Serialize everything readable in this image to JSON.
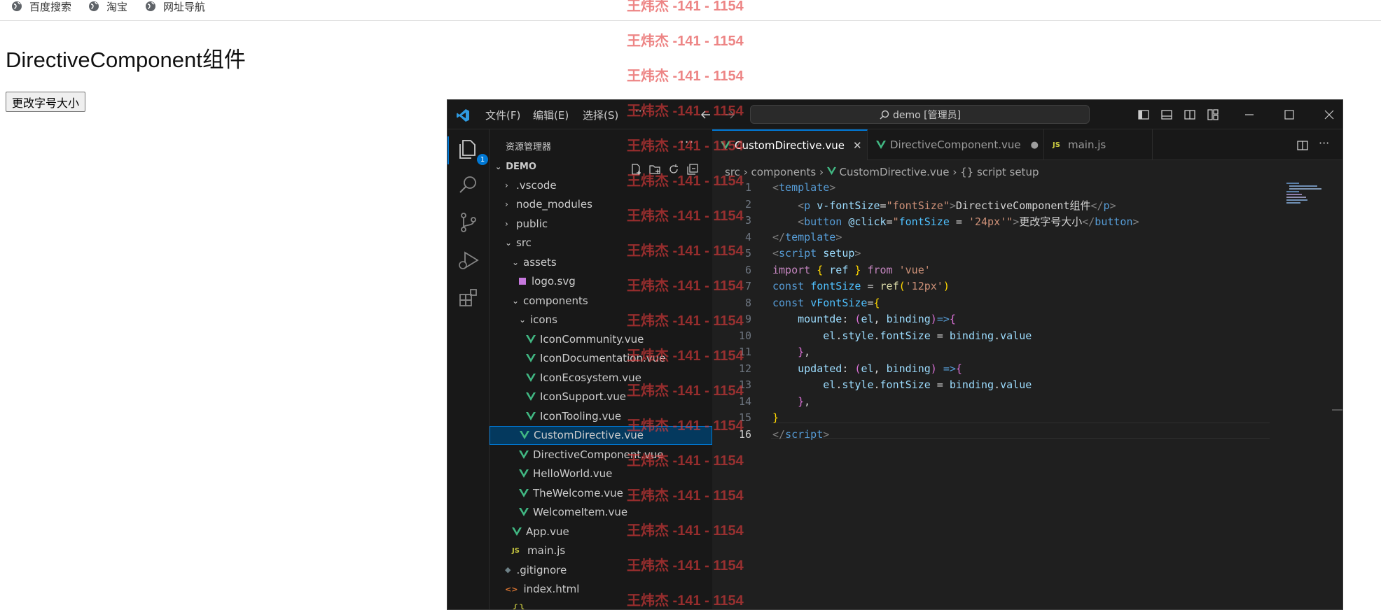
{
  "bookmarks": [
    {
      "label": "百度搜索",
      "icon": "globe-icon"
    },
    {
      "label": "淘宝",
      "icon": "globe-icon"
    },
    {
      "label": "网址导航",
      "icon": "globe-icon"
    }
  ],
  "page": {
    "title": "DirectiveComponent组件",
    "button_label": "更改字号大小"
  },
  "vscode": {
    "menu": [
      "文件(F)",
      "编辑(E)",
      "选择(S)",
      "···"
    ],
    "search_label": "demo [管理员]",
    "explorer_title": "资源管理器",
    "explorer_more": "···",
    "explorer_badge": "1",
    "root_folder": "DEMO",
    "tree": [
      {
        "label": ".vscode",
        "kind": "folder",
        "open": false,
        "depth": 0
      },
      {
        "label": "node_modules",
        "kind": "folder",
        "open": false,
        "depth": 0
      },
      {
        "label": "public",
        "kind": "folder",
        "open": false,
        "depth": 0
      },
      {
        "label": "src",
        "kind": "folder",
        "open": true,
        "depth": 0
      },
      {
        "label": "assets",
        "kind": "folder",
        "open": true,
        "depth": 1
      },
      {
        "label": "logo.svg",
        "kind": "svg",
        "depth": 2
      },
      {
        "label": "components",
        "kind": "folder",
        "open": true,
        "depth": 1
      },
      {
        "label": "icons",
        "kind": "folder",
        "open": true,
        "depth": 2
      },
      {
        "label": "IconCommunity.vue",
        "kind": "vue",
        "depth": 3
      },
      {
        "label": "IconDocumentation.vue",
        "kind": "vue",
        "depth": 3
      },
      {
        "label": "IconEcosystem.vue",
        "kind": "vue",
        "depth": 3
      },
      {
        "label": "IconSupport.vue",
        "kind": "vue",
        "depth": 3
      },
      {
        "label": "IconTooling.vue",
        "kind": "vue",
        "depth": 3
      },
      {
        "label": "CustomDirective.vue",
        "kind": "vue",
        "depth": 2,
        "selected": true
      },
      {
        "label": "DirectiveComponent.vue",
        "kind": "vue",
        "depth": 2
      },
      {
        "label": "HelloWorld.vue",
        "kind": "vue",
        "depth": 2
      },
      {
        "label": "TheWelcome.vue",
        "kind": "vue",
        "depth": 2
      },
      {
        "label": "WelcomeItem.vue",
        "kind": "vue",
        "depth": 2
      },
      {
        "label": "App.vue",
        "kind": "vue",
        "depth": 1
      },
      {
        "label": "main.js",
        "kind": "js",
        "depth": 1
      },
      {
        "label": ".gitignore",
        "kind": "git",
        "depth": 0
      },
      {
        "label": "index.html",
        "kind": "html",
        "depth": 0
      },
      {
        "label": "{}",
        "kind": "json",
        "depth": 1
      }
    ],
    "tabs": [
      {
        "label": "CustomDirective.vue",
        "active": true,
        "close": "✕"
      },
      {
        "label": "DirectiveComponent.vue",
        "active": false,
        "close": "●"
      },
      {
        "label": "main.js",
        "active": false,
        "close": ""
      }
    ],
    "tab_js_badge": "JS",
    "breadcrumb": {
      "p1": "src",
      "p2": "components",
      "p3": "CustomDirective.vue",
      "p4": "{} script setup"
    },
    "code_line_numbers": [
      "1",
      "2",
      "3",
      "4",
      "5",
      "6",
      "7",
      "8",
      "9",
      "10",
      "11",
      "12",
      "13",
      "14",
      "15",
      "16"
    ],
    "current_line": "16"
  },
  "watermark": {
    "text": "王炜杰 -141 - 1154"
  },
  "colors": {
    "accent": "#0078d4",
    "watermark": "#e33b3b",
    "vue_green": "#41b883"
  }
}
